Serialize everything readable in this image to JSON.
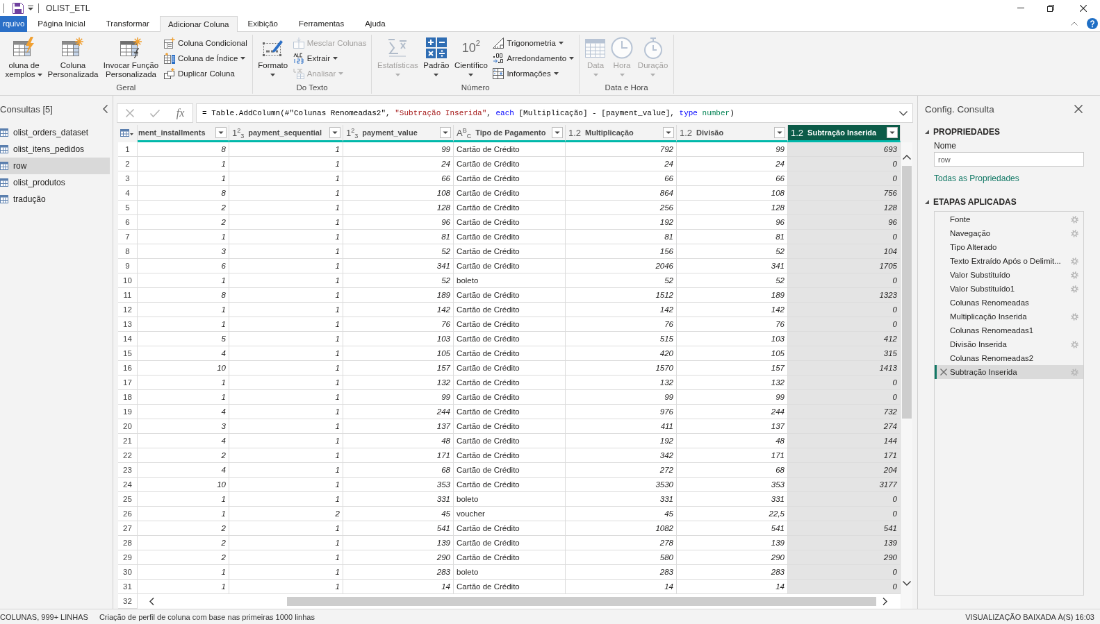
{
  "title_bar": {
    "title": "OLIST_ETL"
  },
  "ribbon_tabs": [
    {
      "label": "rquivo",
      "kind": "file",
      "selected": false
    },
    {
      "label": "Página Inicial",
      "kind": "tab",
      "selected": false
    },
    {
      "label": "Transformar",
      "kind": "tab",
      "selected": false
    },
    {
      "label": "Adicionar Coluna",
      "kind": "tab",
      "selected": true
    },
    {
      "label": "Exibição",
      "kind": "tab",
      "selected": false
    },
    {
      "label": "Ferramentas",
      "kind": "tab",
      "selected": false
    },
    {
      "label": "Ajuda",
      "kind": "tab",
      "selected": false
    }
  ],
  "ribbon_groups": [
    {
      "label": "Geral",
      "large_buttons": [
        {
          "label": "oluna de xemplos",
          "kind": "examples",
          "dropdown": true,
          "disabled": false
        },
        {
          "label": "Coluna Personalizada",
          "kind": "custom",
          "dropdown": false,
          "disabled": false
        },
        {
          "label": "Invocar Função Personalizada",
          "kind": "invoke",
          "dropdown": false,
          "disabled": false
        }
      ],
      "small_buttons": [
        {
          "label": "Coluna Condicional",
          "kind": "conditional",
          "dropdown": false,
          "disabled": false
        },
        {
          "label": "Coluna de Índice",
          "kind": "index",
          "dropdown": true,
          "disabled": false
        },
        {
          "label": "Duplicar Coluna",
          "kind": "duplicate",
          "dropdown": false,
          "disabled": false
        }
      ]
    },
    {
      "label": "Do Texto",
      "large_buttons": [
        {
          "label": "Formato",
          "kind": "format",
          "dropdown": true,
          "disabled": false
        }
      ],
      "small_buttons": [
        {
          "label": "Mesclar Colunas",
          "kind": "merge",
          "dropdown": false,
          "disabled": true
        },
        {
          "label": "Extrair",
          "kind": "extract",
          "dropdown": true,
          "disabled": false
        },
        {
          "label": "Analisar",
          "kind": "parse",
          "dropdown": true,
          "disabled": true
        }
      ]
    },
    {
      "label": "Número",
      "large_buttons": [
        {
          "label": "Estatísticas",
          "kind": "statistics",
          "dropdown": true,
          "disabled": true
        },
        {
          "label": "Padrão",
          "kind": "standard",
          "dropdown": true,
          "disabled": false
        },
        {
          "label": "Científico",
          "kind": "scientific",
          "icon_text": "10$^{2}$",
          "dropdown": true,
          "disabled": false
        }
      ],
      "small_buttons": [
        {
          "label": "Trigonometria",
          "kind": "trigonometry",
          "dropdown": true,
          "disabled": false
        },
        {
          "label": "Arredondamento",
          "kind": "rounding",
          "dropdown": true,
          "disabled": false
        },
        {
          "label": "Informações",
          "kind": "information",
          "dropdown": true,
          "disabled": false
        }
      ]
    },
    {
      "label": "Data e Hora",
      "large_buttons": [
        {
          "label": "Data",
          "kind": "date",
          "dropdown": true,
          "disabled": true
        },
        {
          "label": "Hora",
          "kind": "time",
          "dropdown": true,
          "disabled": true
        },
        {
          "label": "Duração",
          "kind": "duration",
          "dropdown": true,
          "disabled": true
        }
      ]
    }
  ],
  "queries_pane": {
    "title": "Consultas [5]",
    "items": [
      {
        "label": "olist_orders_dataset",
        "selected": false
      },
      {
        "label": "olist_itens_pedidos",
        "selected": false
      },
      {
        "label": "row",
        "selected": true
      },
      {
        "label": "olist_produtos",
        "selected": false
      },
      {
        "label": "tradução",
        "selected": false
      }
    ]
  },
  "formula_bar": {
    "fx_label": "fx",
    "segments": [
      {
        "kind": "plain",
        "text": "= Table.AddColumn(#\"Colunas Renomeadas2\", "
      },
      {
        "kind": "string",
        "text": "\"Subtração Inserida\""
      },
      {
        "kind": "plain",
        "text": ", "
      },
      {
        "kind": "keyword",
        "text": "each"
      },
      {
        "kind": "plain",
        "text": " [Multiplicação] - [payment_value], "
      },
      {
        "kind": "keyword",
        "text": "type"
      },
      {
        "kind": "typename",
        "text": " number"
      },
      {
        "kind": "plain",
        "text": ")"
      }
    ]
  },
  "table": {
    "columns": [
      {
        "label": "ment_installments",
        "kind": "number",
        "selected": false
      },
      {
        "label": "payment_sequential",
        "kind": "number",
        "type_label": "1$^{2}$$_{3}$",
        "selected": false
      },
      {
        "label": "payment_value",
        "kind": "number",
        "type_label": "1$^{2}$$_{3}$",
        "selected": false
      },
      {
        "label": "Tipo de Pagamento",
        "kind": "text",
        "type_label": "A$^{B}$$_{C}$",
        "selected": false
      },
      {
        "label": "Multiplicação",
        "kind": "number",
        "type_label": "1.2",
        "selected": false
      },
      {
        "label": "Divisão",
        "kind": "number",
        "type_label": "1.2",
        "selected": false
      },
      {
        "label": "Subtração Inserida",
        "kind": "number",
        "type_label": "1.2",
        "selected": true
      }
    ],
    "rows": [
      {
        "number": "1",
        "cells": [
          "8",
          "1",
          "99",
          "Cartão de Crédito",
          "792",
          "99",
          "693"
        ]
      },
      {
        "number": "2",
        "cells": [
          "1",
          "1",
          "24",
          "Cartão de Crédito",
          "24",
          "24",
          "0"
        ]
      },
      {
        "number": "3",
        "cells": [
          "1",
          "1",
          "66",
          "Cartão de Crédito",
          "66",
          "66",
          "0"
        ]
      },
      {
        "number": "4",
        "cells": [
          "8",
          "1",
          "108",
          "Cartão de Crédito",
          "864",
          "108",
          "756"
        ]
      },
      {
        "number": "5",
        "cells": [
          "2",
          "1",
          "128",
          "Cartão de Crédito",
          "256",
          "128",
          "128"
        ]
      },
      {
        "number": "6",
        "cells": [
          "2",
          "1",
          "96",
          "Cartão de Crédito",
          "192",
          "96",
          "96"
        ]
      },
      {
        "number": "7",
        "cells": [
          "1",
          "1",
          "81",
          "Cartão de Crédito",
          "81",
          "81",
          "0"
        ]
      },
      {
        "number": "8",
        "cells": [
          "3",
          "1",
          "52",
          "Cartão de Crédito",
          "156",
          "52",
          "104"
        ]
      },
      {
        "number": "9",
        "cells": [
          "6",
          "1",
          "341",
          "Cartão de Crédito",
          "2046",
          "341",
          "1705"
        ]
      },
      {
        "number": "10",
        "cells": [
          "1",
          "1",
          "52",
          "boleto",
          "52",
          "52",
          "0"
        ]
      },
      {
        "number": "11",
        "cells": [
          "8",
          "1",
          "189",
          "Cartão de Crédito",
          "1512",
          "189",
          "1323"
        ]
      },
      {
        "number": "12",
        "cells": [
          "1",
          "1",
          "142",
          "Cartão de Crédito",
          "142",
          "142",
          "0"
        ]
      },
      {
        "number": "13",
        "cells": [
          "1",
          "1",
          "76",
          "Cartão de Crédito",
          "76",
          "76",
          "0"
        ]
      },
      {
        "number": "14",
        "cells": [
          "5",
          "1",
          "103",
          "Cartão de Crédito",
          "515",
          "103",
          "412"
        ]
      },
      {
        "number": "15",
        "cells": [
          "4",
          "1",
          "105",
          "Cartão de Crédito",
          "420",
          "105",
          "315"
        ]
      },
      {
        "number": "16",
        "cells": [
          "10",
          "1",
          "157",
          "Cartão de Crédito",
          "1570",
          "157",
          "1413"
        ]
      },
      {
        "number": "17",
        "cells": [
          "1",
          "1",
          "132",
          "Cartão de Crédito",
          "132",
          "132",
          "0"
        ]
      },
      {
        "number": "18",
        "cells": [
          "1",
          "1",
          "99",
          "Cartão de Crédito",
          "99",
          "99",
          "0"
        ]
      },
      {
        "number": "19",
        "cells": [
          "4",
          "1",
          "244",
          "Cartão de Crédito",
          "976",
          "244",
          "732"
        ]
      },
      {
        "number": "20",
        "cells": [
          "3",
          "1",
          "137",
          "Cartão de Crédito",
          "411",
          "137",
          "274"
        ]
      },
      {
        "number": "21",
        "cells": [
          "4",
          "1",
          "48",
          "Cartão de Crédito",
          "192",
          "48",
          "144"
        ]
      },
      {
        "number": "22",
        "cells": [
          "2",
          "1",
          "171",
          "Cartão de Crédito",
          "342",
          "171",
          "171"
        ]
      },
      {
        "number": "23",
        "cells": [
          "4",
          "1",
          "68",
          "Cartão de Crédito",
          "272",
          "68",
          "204"
        ]
      },
      {
        "number": "24",
        "cells": [
          "10",
          "1",
          "353",
          "Cartão de Crédito",
          "3530",
          "353",
          "3177"
        ]
      },
      {
        "number": "25",
        "cells": [
          "1",
          "1",
          "331",
          "boleto",
          "331",
          "331",
          "0"
        ]
      },
      {
        "number": "26",
        "cells": [
          "1",
          "2",
          "45",
          "voucher",
          "45",
          "22,5",
          "0"
        ]
      },
      {
        "number": "27",
        "cells": [
          "2",
          "1",
          "541",
          "Cartão de Crédito",
          "1082",
          "541",
          "541"
        ]
      },
      {
        "number": "28",
        "cells": [
          "2",
          "1",
          "139",
          "Cartão de Crédito",
          "278",
          "139",
          "139"
        ]
      },
      {
        "number": "29",
        "cells": [
          "2",
          "1",
          "290",
          "Cartão de Crédito",
          "580",
          "290",
          "290"
        ]
      },
      {
        "number": "30",
        "cells": [
          "1",
          "1",
          "283",
          "boleto",
          "283",
          "283",
          "0"
        ]
      },
      {
        "number": "31",
        "cells": [
          "1",
          "1",
          "14",
          "Cartão de Crédito",
          "14",
          "14",
          "0"
        ]
      },
      {
        "number": "32"
      }
    ]
  },
  "query_settings": {
    "title": "Config. Consulta",
    "properties": {
      "heading": "PROPRIEDADES",
      "expanded": true,
      "name_label": "Nome",
      "name_value": "row",
      "link": "Todas as Propriedades"
    },
    "applied_steps": {
      "heading": "ETAPAS APLICADAS",
      "expanded": true,
      "items": [
        {
          "label": "Fonte",
          "settings": true,
          "selected": false
        },
        {
          "label": "Navegação",
          "settings": true,
          "selected": false
        },
        {
          "label": "Tipo Alterado",
          "settings": false,
          "selected": false
        },
        {
          "label": "Texto Extraído Após o Delimit...",
          "settings": true,
          "selected": false
        },
        {
          "label": "Valor Substituído",
          "settings": true,
          "selected": false
        },
        {
          "label": "Valor Substituído1",
          "settings": true,
          "selected": false
        },
        {
          "label": "Colunas Renomeadas",
          "settings": false,
          "selected": false
        },
        {
          "label": "Multiplicação Inserida",
          "settings": true,
          "selected": false
        },
        {
          "label": "Colunas Renomeadas1",
          "settings": false,
          "selected": false
        },
        {
          "label": "Divisão Inserida",
          "settings": true,
          "selected": false
        },
        {
          "label": "Colunas Renomeadas2",
          "settings": false,
          "selected": false
        },
        {
          "label": "Subtração Inserida",
          "settings": true,
          "selected": true
        }
      ]
    }
  },
  "status_bar": {
    "summary": "COLUNAS, 999+ LINHAS",
    "profiling": "Criação de perfil de coluna com base nas primeiras 1000 linhas",
    "preview": "VISUALIZAÇÃO BAIXADA À(S) 16:03"
  }
}
